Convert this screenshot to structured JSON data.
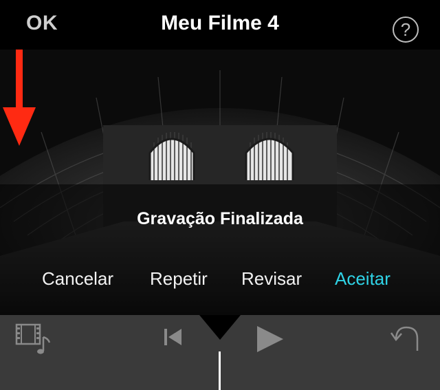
{
  "nav": {
    "ok_label": "OK",
    "title": "Meu Filme 4",
    "help_label": "?"
  },
  "overlay": {
    "title": "Gravação Finalizada",
    "actions": {
      "cancel": "Cancelar",
      "repeat": "Repetir",
      "review": "Revisar",
      "accept": "Aceitar"
    }
  },
  "colors": {
    "accent": "#2fd3e6",
    "annotation_arrow": "#ff2a12",
    "toolbar_bg": "#3a3a3a"
  },
  "icons": {
    "media": "film-music-icon",
    "previous": "skip-back-icon",
    "play": "play-icon",
    "undo": "undo-icon",
    "help": "help-icon"
  }
}
